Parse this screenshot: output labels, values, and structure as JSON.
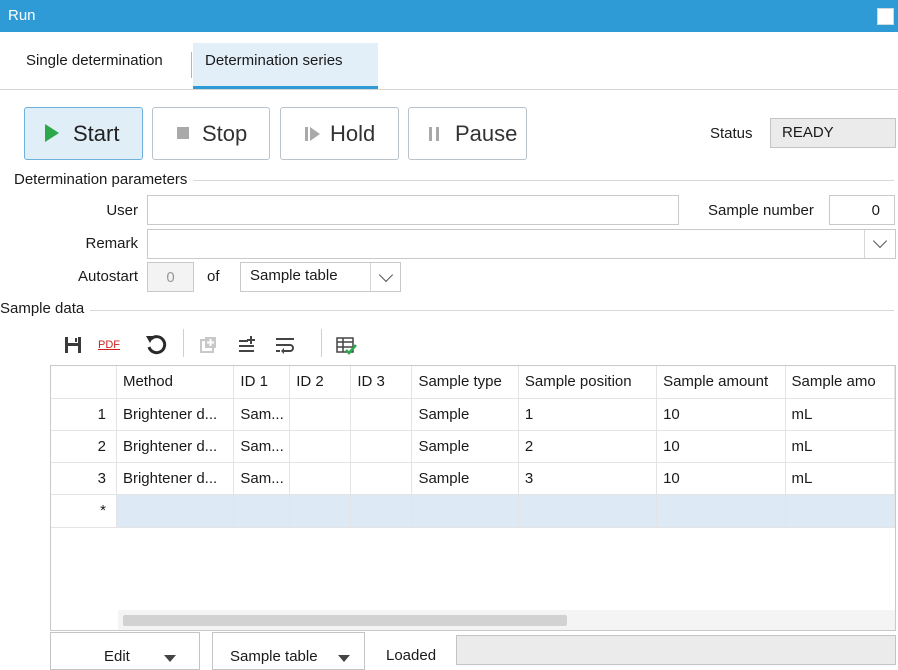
{
  "window": {
    "title": "Run"
  },
  "tabs": [
    {
      "label": "Single determination",
      "active": false
    },
    {
      "label": "Determination series",
      "active": true
    }
  ],
  "controls": {
    "start": "Start",
    "stop": "Stop",
    "hold": "Hold",
    "pause": "Pause"
  },
  "status": {
    "label": "Status",
    "value": "READY"
  },
  "params": {
    "section": "Determination parameters",
    "user_label": "User",
    "user_value": "",
    "sample_number_label": "Sample number",
    "sample_number_value": "0",
    "remark_label": "Remark",
    "remark_value": "",
    "autostart_label": "Autostart",
    "autostart_value": "0",
    "of_label": "of",
    "autostart_source": "Sample table"
  },
  "sample_data": {
    "section": "Sample data",
    "toolbar": {
      "pdf_label": "PDF",
      "icons": [
        "save-icon",
        "pdf-export-icon",
        "undo-icon",
        "insert-row-icon",
        "add-lines-icon",
        "wrap-lines-icon",
        "table-check-icon"
      ]
    },
    "columns": [
      "",
      "Method",
      "ID 1",
      "ID 2",
      "ID 3",
      "Sample type",
      "Sample position",
      "Sample amount",
      "Sample amo"
    ],
    "rows": [
      [
        "1",
        "Brightener d...",
        "Sam...",
        "",
        "",
        "Sample",
        "1",
        "10",
        "mL"
      ],
      [
        "2",
        "Brightener d...",
        "Sam...",
        "",
        "",
        "Sample",
        "2",
        "10",
        "mL"
      ],
      [
        "3",
        "Brightener d...",
        "Sam...",
        "",
        "",
        "Sample",
        "3",
        "10",
        "mL"
      ]
    ],
    "new_row_marker": "*"
  },
  "bottom": {
    "edit_label": "Edit",
    "sample_table_label": "Sample table",
    "loaded_label": "Loaded",
    "loaded_value": ""
  },
  "colors": {
    "accent": "#2e9bd6",
    "start_icon": "#2ba84a",
    "selected_row": "#dde9f4"
  }
}
